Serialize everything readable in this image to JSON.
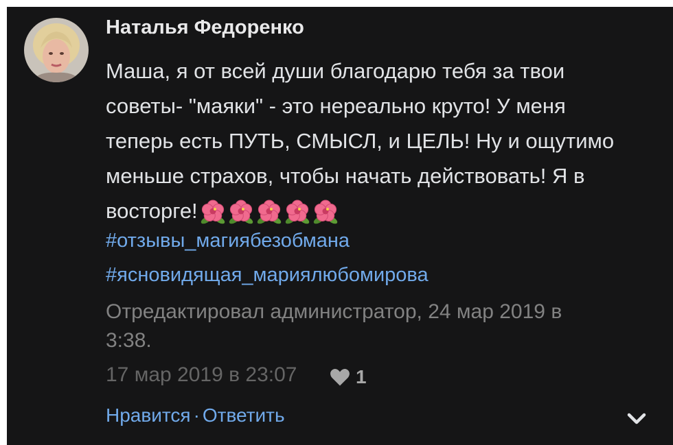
{
  "comment": {
    "author": "Наталья Федоренко",
    "avatar_icon": "user-avatar-photo",
    "text_lines": [
      "Маша, я от всей души благодарю тебя за твои",
      "советы- \"маяки\" - это нереально круто! У меня",
      "теперь есть ПУТЬ, СМЫСЛ, и ЦЕЛЬ! Ну и ощутимо",
      "меньше страхов, чтобы начать действовать! Я в",
      "восторге!"
    ],
    "emoji_icon": "hibiscus-emoji",
    "emoji_count": 5,
    "hashtags": [
      "#отзывы_магиябезобмана",
      "#ясновидящая_мариялюбомирова"
    ],
    "edited_line_1": "Отредактировал администратор, 24 мар 2019 в",
    "edited_line_2": "3:38.",
    "timestamp": "17 мар 2019 в 23:07",
    "like_icon": "heart-icon",
    "like_count": "1",
    "like_label": "Нравится",
    "separator": "·",
    "reply_label": "Ответить",
    "expand_icon": "chevron-down-icon"
  },
  "colors": {
    "background": "#151516",
    "text": "#e1e3e6",
    "link": "#71aaeb",
    "secondary": "#828282"
  }
}
